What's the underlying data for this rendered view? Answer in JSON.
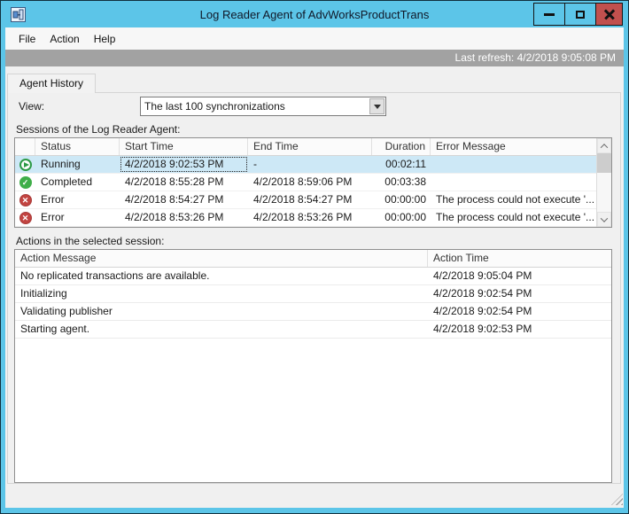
{
  "window": {
    "title": "Log Reader Agent of AdvWorksProductTrans",
    "icon": "replication-monitor-icon",
    "controls": [
      "minimize",
      "maximize",
      "close"
    ]
  },
  "menu": {
    "items": [
      {
        "label": "File"
      },
      {
        "label": "Action"
      },
      {
        "label": "Help"
      }
    ]
  },
  "refresh_bar": {
    "text": "Last refresh: 4/2/2018 9:05:08 PM"
  },
  "tabs": [
    {
      "label": "Agent History",
      "active": true
    }
  ],
  "view": {
    "label": "View:",
    "value": "The last 100 synchronizations"
  },
  "sessions": {
    "label": "Sessions of the Log Reader Agent:",
    "columns": [
      "",
      "Status",
      "Start Time",
      "End Time",
      "Duration",
      "Error Message"
    ],
    "rows": [
      {
        "icon": "running",
        "status": "Running",
        "start_time": "4/2/2018 9:02:53 PM",
        "end_time": "-",
        "duration": "00:02:11",
        "error_message": "",
        "selected": true,
        "focus_cell": "start_time"
      },
      {
        "icon": "completed",
        "status": "Completed",
        "start_time": "4/2/2018 8:55:28 PM",
        "end_time": "4/2/2018 8:59:06 PM",
        "duration": "00:03:38",
        "error_message": ""
      },
      {
        "icon": "error",
        "status": "Error",
        "start_time": "4/2/2018 8:54:27 PM",
        "end_time": "4/2/2018 8:54:27 PM",
        "duration": "00:00:00",
        "error_message": "The process could not execute '..."
      },
      {
        "icon": "error",
        "status": "Error",
        "start_time": "4/2/2018 8:53:26 PM",
        "end_time": "4/2/2018 8:53:26 PM",
        "duration": "00:00:00",
        "error_message": "The process could not execute '..."
      }
    ]
  },
  "actions": {
    "label": "Actions in the selected session:",
    "columns": [
      "Action Message",
      "Action Time"
    ],
    "rows": [
      {
        "message": "No replicated transactions are available.",
        "time": "4/2/2018 9:05:04 PM"
      },
      {
        "message": "Initializing",
        "time": "4/2/2018 9:02:54 PM"
      },
      {
        "message": "Validating publisher",
        "time": "4/2/2018 9:02:54 PM"
      },
      {
        "message": "Starting agent.",
        "time": "4/2/2018 9:02:53 PM"
      }
    ]
  },
  "colors": {
    "titlebar": "#5cc5e8",
    "close_button": "#c1504e",
    "refresh_bar": "#a2a2a2",
    "selection": "#cde8f6",
    "status_running": "#2d9a46",
    "status_completed": "#3fae49",
    "status_error": "#c24441"
  }
}
